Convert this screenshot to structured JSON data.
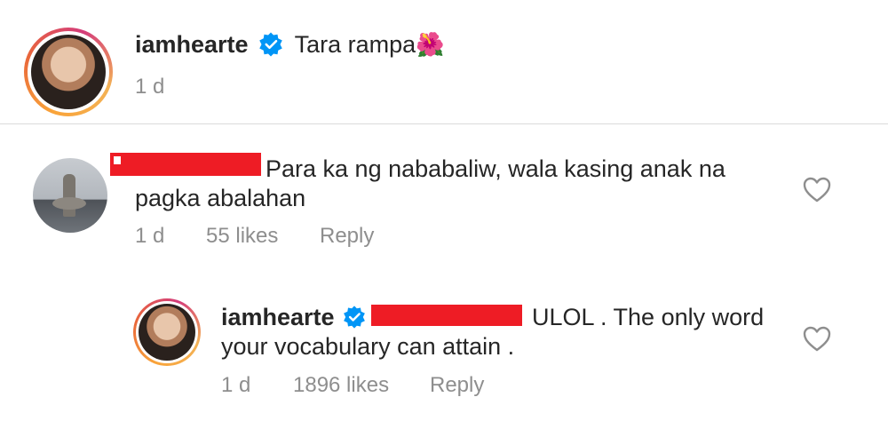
{
  "post": {
    "username": "iamhearte",
    "caption_text": "Tara rampa",
    "caption_emoji": "🌺",
    "time": "1 d"
  },
  "comment": {
    "text_line1": "Para ka ng nababaliw, wala kasing anak na",
    "text_line2": "pagka abalahan",
    "time": "1 d",
    "likes": "55 likes",
    "reply_label": "Reply"
  },
  "reply": {
    "username": "iamhearte",
    "text_line1": "ULOL . The only word",
    "text_line2": "your vocabulary can attain .",
    "time": "1 d",
    "likes": "1896 likes",
    "reply_label": "Reply"
  },
  "colors": {
    "verified_blue": "#0095f6",
    "redaction_red": "#ee1c25",
    "meta_gray": "#8e8e8e"
  }
}
